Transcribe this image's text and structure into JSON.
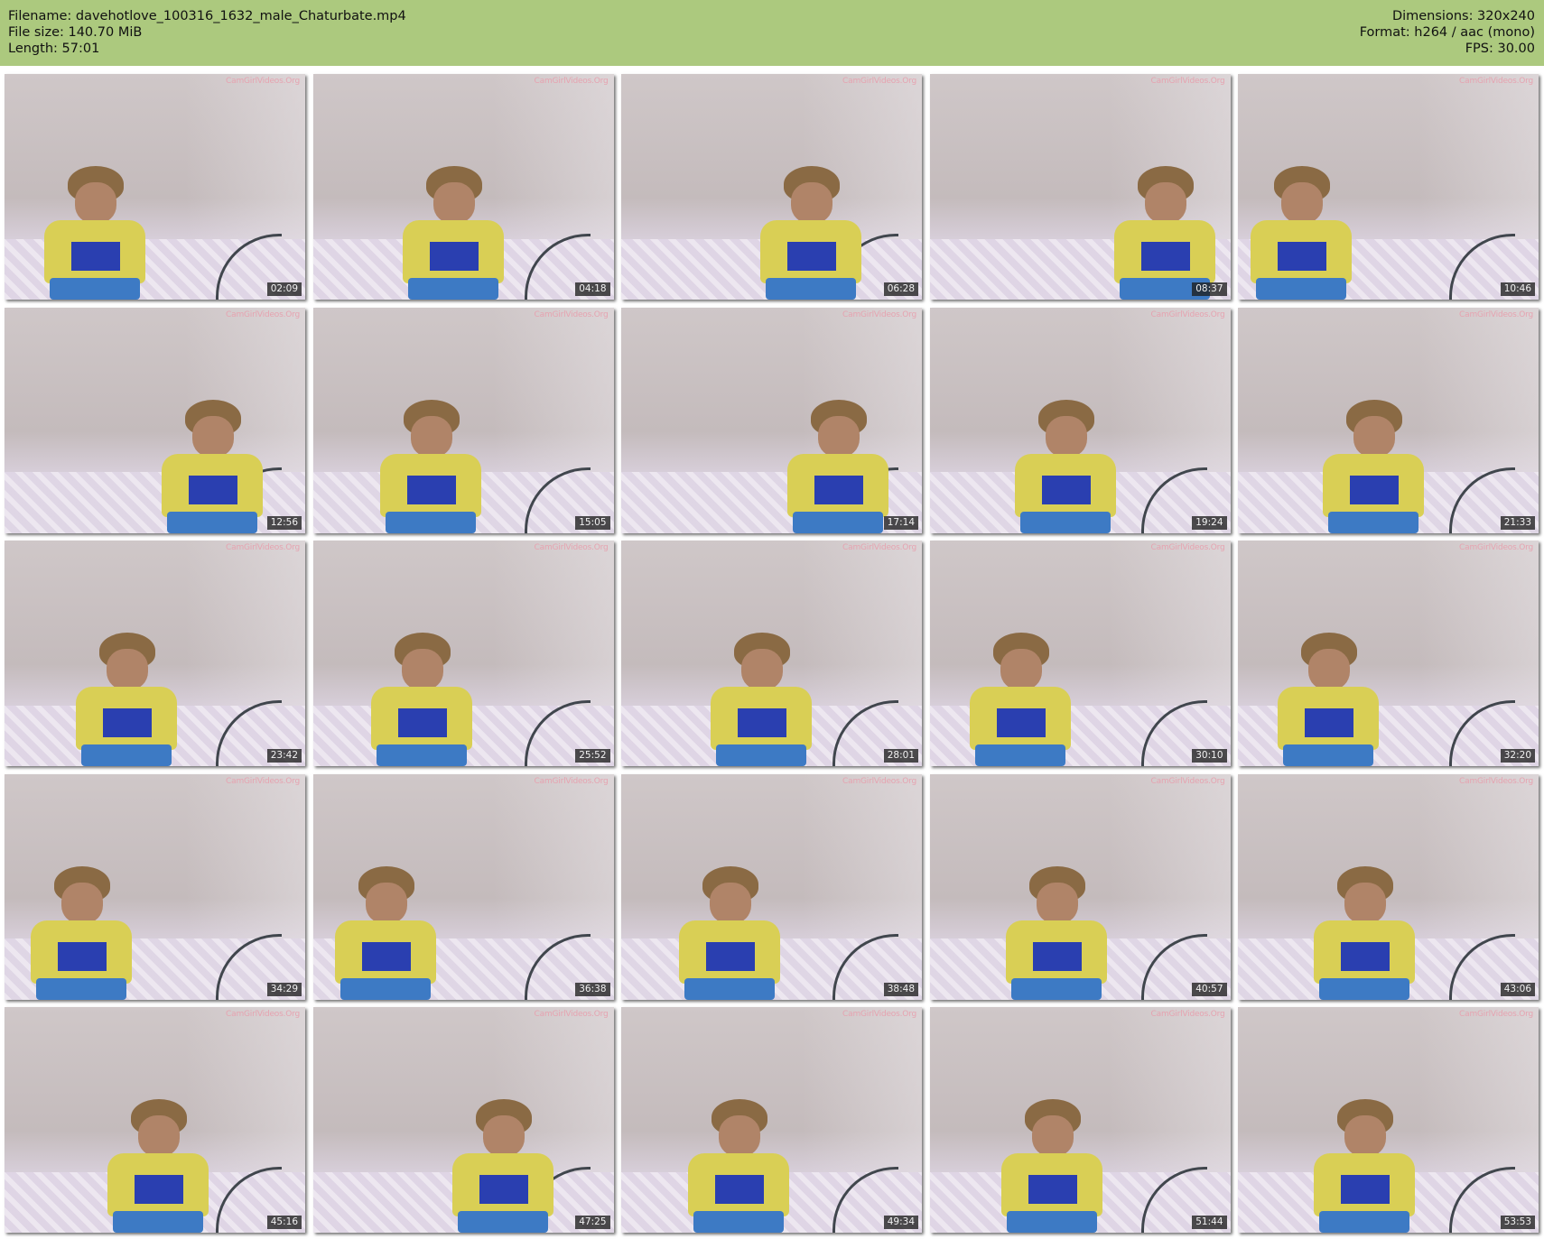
{
  "header": {
    "filename": "Filename: davehotlove_100316_1632_male_Chaturbate.mp4",
    "filesize": "File size: 140.70 MiB",
    "length": "Length: 57:01",
    "dimensions": "Dimensions: 320x240",
    "format": "Format: h264 / aac (mono)",
    "fps": "FPS: 30.00"
  },
  "watermark": "CamGirlVideos.Org",
  "thumbnails": [
    {
      "timestamp": "02:09"
    },
    {
      "timestamp": "04:18"
    },
    {
      "timestamp": "06:28"
    },
    {
      "timestamp": "08:37"
    },
    {
      "timestamp": "10:46"
    },
    {
      "timestamp": "12:56"
    },
    {
      "timestamp": "15:05"
    },
    {
      "timestamp": "17:14"
    },
    {
      "timestamp": "19:24"
    },
    {
      "timestamp": "21:33"
    },
    {
      "timestamp": "23:42"
    },
    {
      "timestamp": "25:52"
    },
    {
      "timestamp": "28:01"
    },
    {
      "timestamp": "30:10"
    },
    {
      "timestamp": "32:20"
    },
    {
      "timestamp": "34:29"
    },
    {
      "timestamp": "36:38"
    },
    {
      "timestamp": "38:48"
    },
    {
      "timestamp": "40:57"
    },
    {
      "timestamp": "43:06"
    },
    {
      "timestamp": "45:16"
    },
    {
      "timestamp": "47:25"
    },
    {
      "timestamp": "49:34"
    },
    {
      "timestamp": "51:44"
    },
    {
      "timestamp": "53:53"
    }
  ],
  "colors": {
    "header_bg": "#acc97e",
    "shirt": "#d9cf55",
    "shorts": "#3d7ac4",
    "timestamp_bg": "#1e1e1e"
  }
}
